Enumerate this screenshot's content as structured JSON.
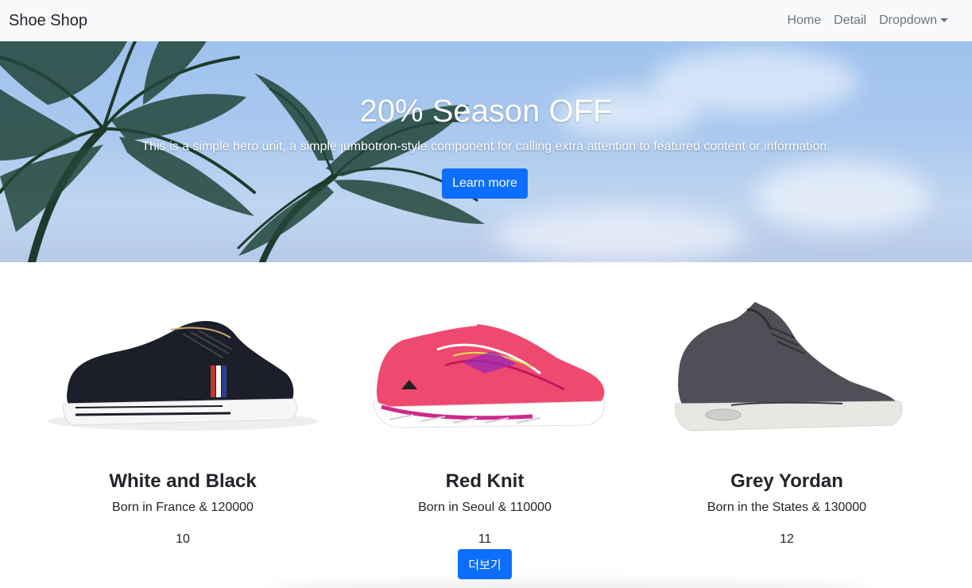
{
  "navbar": {
    "brand": "Shoe Shop",
    "links": [
      {
        "label": "Home"
      },
      {
        "label": "Detail"
      },
      {
        "label": "Dropdown"
      }
    ]
  },
  "hero": {
    "title": "20% Season OFF",
    "text": "This is a simple hero unit, a simple jumbotron-style component for calling extra attention to featured content or information.",
    "button_label": "Learn more"
  },
  "products": [
    {
      "title": "White and Black",
      "desc": "Born in France & 120000",
      "id": "10"
    },
    {
      "title": "Red Knit",
      "desc": "Born in Seoul & 110000",
      "id": "11"
    },
    {
      "title": "Grey Yordan",
      "desc": "Born in the States & 130000",
      "id": "12"
    }
  ],
  "more_button_label": "더보기",
  "colors": {
    "primary": "#0d6efd",
    "navbar_bg": "#f8f9fa",
    "nav_link": "#6c757d"
  }
}
